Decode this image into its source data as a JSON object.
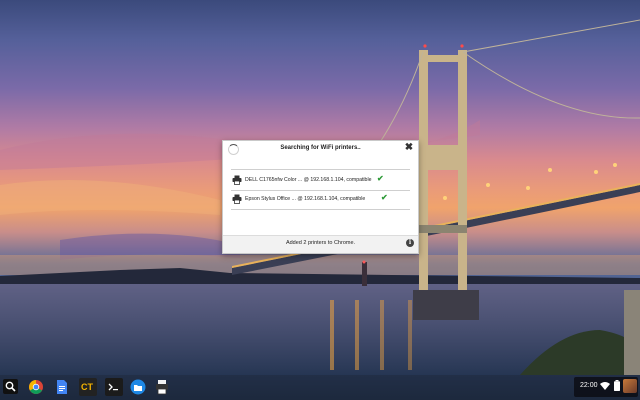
{
  "dialog": {
    "title": "Searching for WiFi printers..",
    "close_icon": "close-icon",
    "spinner_icon": "loading-spinner-icon",
    "printers": [
      {
        "name": "DELL C1765nfw Color ... @ 192.168.1.104, compatible",
        "icon": "printer-icon",
        "status_icon": "checkmark-icon"
      },
      {
        "name": "Epson Stylus Office ... @ 192.168.1.104, compatible",
        "icon": "printer-icon",
        "status_icon": "checkmark-icon"
      }
    ],
    "footer_text": "Added 2 printers to Chrome.",
    "info_icon": "info-icon",
    "info_glyph": "i"
  },
  "shelf": {
    "apps": [
      {
        "name": "launcher",
        "icon": "search-icon"
      },
      {
        "name": "chrome",
        "icon": "chrome-icon"
      },
      {
        "name": "docs",
        "icon": "docs-icon"
      },
      {
        "name": "ct",
        "icon": "ct-app-icon",
        "label": "CT"
      },
      {
        "name": "terminal",
        "icon": "terminal-icon"
      },
      {
        "name": "files",
        "icon": "files-icon"
      },
      {
        "name": "printer-app",
        "icon": "printer-app-icon"
      }
    ],
    "clock": "22:00",
    "tray_icons": [
      "wifi-icon",
      "battery-icon",
      "avatar"
    ]
  },
  "colors": {
    "check_green": "#2e9b38",
    "shelf_bg": "#14161e"
  }
}
